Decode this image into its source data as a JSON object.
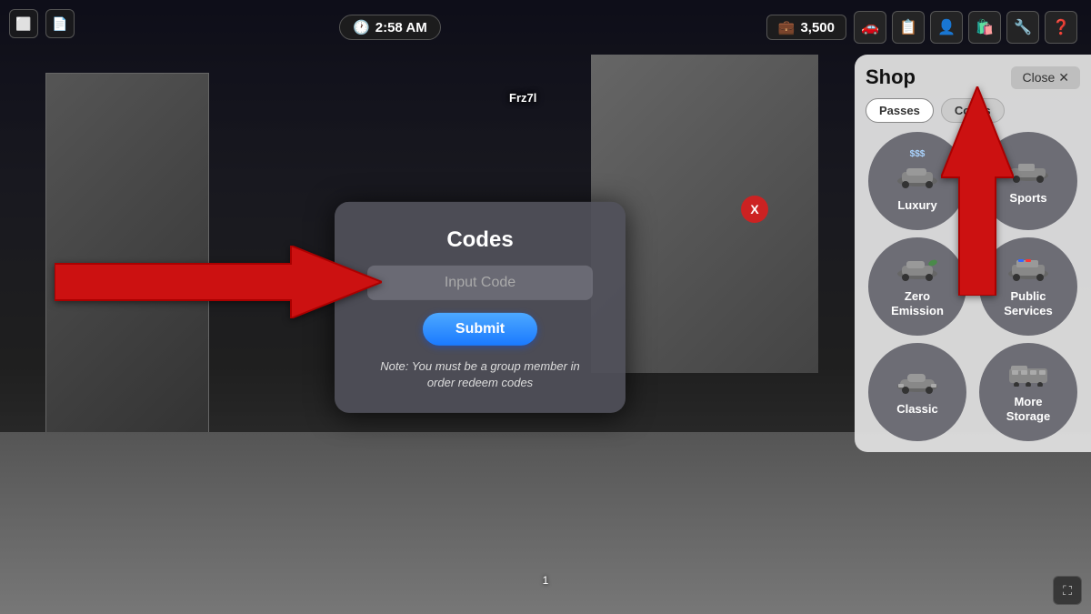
{
  "game": {
    "bg_color": "#1a1a2e"
  },
  "hud": {
    "time": "2:58 AM",
    "currency": "3,500",
    "player_name": "Frz7l"
  },
  "modal": {
    "title": "Codes",
    "input_placeholder": "Input Code",
    "submit_label": "Submit",
    "note": "Note: You must be a group member in order redeem codes",
    "close_label": "X"
  },
  "shop": {
    "title": "Shop",
    "close_label": "Close",
    "close_icon": "✕",
    "tabs": [
      {
        "label": "Passes",
        "active": true
      },
      {
        "label": "Codes",
        "active": false
      }
    ],
    "items": [
      {
        "id": "luxury",
        "label": "Luxury",
        "sublabel": "$$$",
        "icon": "🚗"
      },
      {
        "id": "sports",
        "label": "Sports",
        "sublabel": "",
        "icon": "🏎️"
      },
      {
        "id": "zero-emission",
        "label": "Zero\nEmission",
        "sublabel": "",
        "icon": "🚗"
      },
      {
        "id": "public-services",
        "label": "Public\nServices",
        "sublabel": "",
        "icon": "🚓"
      },
      {
        "id": "classic",
        "label": "Classic",
        "sublabel": "",
        "icon": "🚗"
      },
      {
        "id": "more-storage",
        "label": "More\nStorage",
        "sublabel": "",
        "icon": "🚌"
      }
    ]
  },
  "nav_icons": [
    "🚗",
    "📋",
    "👤",
    "🛍️",
    "🔧",
    "❓"
  ],
  "bottom_indicator": "1"
}
